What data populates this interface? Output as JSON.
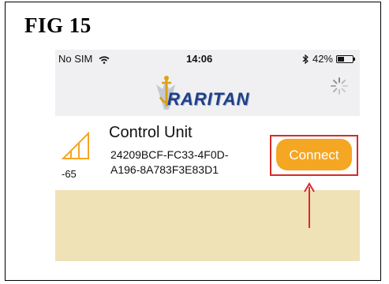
{
  "figure": {
    "title": "FIG 15"
  },
  "status_bar": {
    "carrier": "No SIM",
    "time": "14:06",
    "battery": "42%",
    "battery_level": 0.42
  },
  "nav": {
    "logo_text": "RARITAN",
    "logo_icon": "anchor-logo-icon",
    "spinner_icon": "loading-spinner-icon"
  },
  "device": {
    "name": "Control Unit",
    "id_line1": "24209BCF-FC33-4F0D-",
    "id_line2": "A196-8A783F3E83D1",
    "rssi": "-65",
    "signal_icon": "signal-strength-icon"
  },
  "actions": {
    "connect_label": "Connect"
  },
  "colors": {
    "accent": "#f5a623",
    "highlight": "#d62a2a",
    "background_panel": "#efe2b7"
  }
}
